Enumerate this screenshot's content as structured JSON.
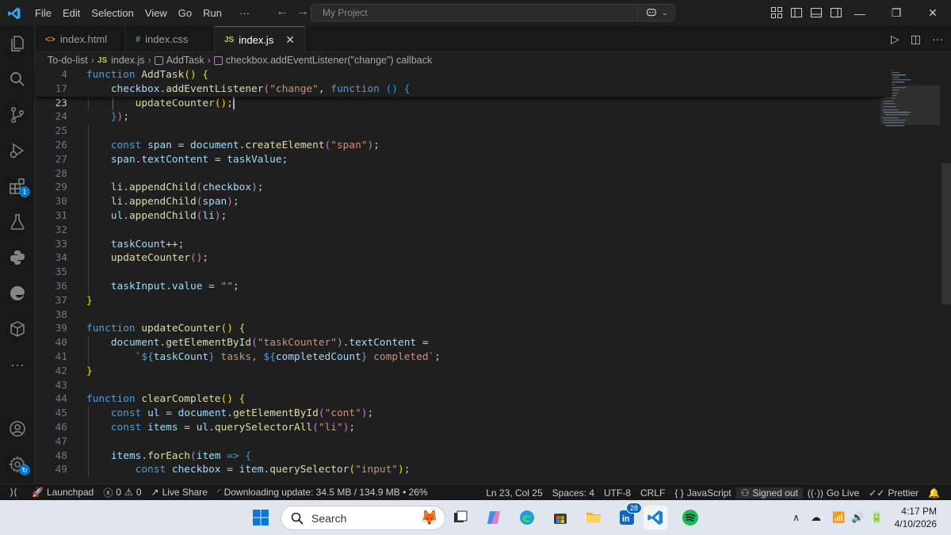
{
  "menu": [
    "File",
    "Edit",
    "Selection",
    "View",
    "Go",
    "Run"
  ],
  "menu_more": "···",
  "command_center": {
    "placeholder": "My Project"
  },
  "tabs": [
    {
      "icon": "<>",
      "label": "index.html",
      "active": false
    },
    {
      "icon": "#",
      "label": "index.css",
      "active": false
    },
    {
      "icon": "JS",
      "label": "index.js",
      "active": true
    }
  ],
  "breadcrumb": {
    "folder": "To-do-list",
    "file_icon": "JS",
    "file": "index.js",
    "symbol1": "AddTask",
    "symbol2": "checkbox.addEventListener(\"change\") callback"
  },
  "activity_badge": "1",
  "code_lines": [
    {
      "n": "4",
      "sticky": true,
      "tokens": [
        [
          "kw",
          "function "
        ],
        [
          "fn",
          "AddTask"
        ],
        [
          "br1",
          "() {"
        ]
      ]
    },
    {
      "n": "17",
      "sticky": true,
      "tokens": [
        [
          "plain",
          "    "
        ],
        [
          "var",
          "checkbox"
        ],
        [
          "plain",
          "."
        ],
        [
          "fn",
          "addEventListener"
        ],
        [
          "br2",
          "("
        ],
        [
          "str",
          "\"change\""
        ],
        [
          "plain",
          ", "
        ],
        [
          "kw",
          "function "
        ],
        [
          "br3",
          "() {"
        ]
      ]
    },
    {
      "n": "23",
      "current": true,
      "tokens": [
        [
          "plain",
          "        "
        ],
        [
          "fn",
          "updateCounter"
        ],
        [
          "br1",
          "()"
        ],
        [
          "plain",
          ";"
        ]
      ]
    },
    {
      "n": "24",
      "tokens": [
        [
          "plain",
          "    "
        ],
        [
          "br3",
          "}"
        ],
        [
          "br2",
          ")"
        ],
        [
          "plain",
          ";"
        ]
      ]
    },
    {
      "n": "25",
      "tokens": []
    },
    {
      "n": "26",
      "tokens": [
        [
          "plain",
          "    "
        ],
        [
          "kw",
          "const "
        ],
        [
          "var",
          "span"
        ],
        [
          "plain",
          " = "
        ],
        [
          "var",
          "document"
        ],
        [
          "plain",
          "."
        ],
        [
          "fn",
          "createElement"
        ],
        [
          "br2",
          "("
        ],
        [
          "str",
          "\"span\""
        ],
        [
          "br2",
          ")"
        ],
        [
          "plain",
          ";"
        ]
      ]
    },
    {
      "n": "27",
      "tokens": [
        [
          "plain",
          "    "
        ],
        [
          "var",
          "span"
        ],
        [
          "plain",
          "."
        ],
        [
          "var",
          "textContent"
        ],
        [
          "plain",
          " = "
        ],
        [
          "var",
          "taskValue"
        ],
        [
          "plain",
          ";"
        ]
      ]
    },
    {
      "n": "28",
      "tokens": []
    },
    {
      "n": "29",
      "tokens": [
        [
          "plain",
          "    "
        ],
        [
          "var",
          "li"
        ],
        [
          "plain",
          "."
        ],
        [
          "fn",
          "appendChild"
        ],
        [
          "br2",
          "("
        ],
        [
          "var",
          "checkbox"
        ],
        [
          "br2",
          ")"
        ],
        [
          "plain",
          ";"
        ]
      ]
    },
    {
      "n": "30",
      "tokens": [
        [
          "plain",
          "    "
        ],
        [
          "var",
          "li"
        ],
        [
          "plain",
          "."
        ],
        [
          "fn",
          "appendChild"
        ],
        [
          "br2",
          "("
        ],
        [
          "var",
          "span"
        ],
        [
          "br2",
          ")"
        ],
        [
          "plain",
          ";"
        ]
      ]
    },
    {
      "n": "31",
      "tokens": [
        [
          "plain",
          "    "
        ],
        [
          "var",
          "ul"
        ],
        [
          "plain",
          "."
        ],
        [
          "fn",
          "appendChild"
        ],
        [
          "br2",
          "("
        ],
        [
          "var",
          "li"
        ],
        [
          "br2",
          ")"
        ],
        [
          "plain",
          ";"
        ]
      ]
    },
    {
      "n": "32",
      "tokens": []
    },
    {
      "n": "33",
      "tokens": [
        [
          "plain",
          "    "
        ],
        [
          "var",
          "taskCount"
        ],
        [
          "plain",
          "++;"
        ]
      ]
    },
    {
      "n": "34",
      "tokens": [
        [
          "plain",
          "    "
        ],
        [
          "fn",
          "updateCounter"
        ],
        [
          "br2",
          "()"
        ],
        [
          "plain",
          ";"
        ]
      ]
    },
    {
      "n": "35",
      "tokens": []
    },
    {
      "n": "36",
      "tokens": [
        [
          "plain",
          "    "
        ],
        [
          "var",
          "taskInput"
        ],
        [
          "plain",
          "."
        ],
        [
          "var",
          "value"
        ],
        [
          "plain",
          " = "
        ],
        [
          "str",
          "\"\""
        ],
        [
          "plain",
          ";"
        ]
      ]
    },
    {
      "n": "37",
      "tokens": [
        [
          "br1",
          "}"
        ]
      ]
    },
    {
      "n": "38",
      "tokens": []
    },
    {
      "n": "39",
      "tokens": [
        [
          "kw",
          "function "
        ],
        [
          "fn",
          "updateCounter"
        ],
        [
          "br1",
          "() {"
        ]
      ]
    },
    {
      "n": "40",
      "tokens": [
        [
          "plain",
          "    "
        ],
        [
          "var",
          "document"
        ],
        [
          "plain",
          "."
        ],
        [
          "fn",
          "getElementById"
        ],
        [
          "br2",
          "("
        ],
        [
          "str",
          "\"taskCounter\""
        ],
        [
          "br2",
          ")"
        ],
        [
          "plain",
          "."
        ],
        [
          "var",
          "textContent"
        ],
        [
          "plain",
          " ="
        ]
      ]
    },
    {
      "n": "41",
      "tokens": [
        [
          "plain",
          "        "
        ],
        [
          "str",
          "`"
        ],
        [
          "kw",
          "${"
        ],
        [
          "var",
          "taskCount"
        ],
        [
          "kw",
          "}"
        ],
        [
          "str",
          " tasks, "
        ],
        [
          "kw",
          "${"
        ],
        [
          "var",
          "completedCount"
        ],
        [
          "kw",
          "}"
        ],
        [
          "str",
          " completed`"
        ],
        [
          "plain",
          ";"
        ]
      ]
    },
    {
      "n": "42",
      "tokens": [
        [
          "br1",
          "}"
        ]
      ]
    },
    {
      "n": "43",
      "tokens": []
    },
    {
      "n": "44",
      "tokens": [
        [
          "kw",
          "function "
        ],
        [
          "fn",
          "clearComplete"
        ],
        [
          "br1",
          "() {"
        ]
      ]
    },
    {
      "n": "45",
      "tokens": [
        [
          "plain",
          "    "
        ],
        [
          "kw",
          "const "
        ],
        [
          "var",
          "ul"
        ],
        [
          "plain",
          " = "
        ],
        [
          "var",
          "document"
        ],
        [
          "plain",
          "."
        ],
        [
          "fn",
          "getElementById"
        ],
        [
          "br2",
          "("
        ],
        [
          "str",
          "\"cont\""
        ],
        [
          "br2",
          ")"
        ],
        [
          "plain",
          ";"
        ]
      ]
    },
    {
      "n": "46",
      "tokens": [
        [
          "plain",
          "    "
        ],
        [
          "kw",
          "const "
        ],
        [
          "var",
          "items"
        ],
        [
          "plain",
          " = "
        ],
        [
          "var",
          "ul"
        ],
        [
          "plain",
          "."
        ],
        [
          "fn",
          "querySelectorAll"
        ],
        [
          "br2",
          "("
        ],
        [
          "str",
          "\"li\""
        ],
        [
          "br2",
          ")"
        ],
        [
          "plain",
          ";"
        ]
      ]
    },
    {
      "n": "47",
      "tokens": []
    },
    {
      "n": "48",
      "tokens": [
        [
          "plain",
          "    "
        ],
        [
          "var",
          "items"
        ],
        [
          "plain",
          "."
        ],
        [
          "fn",
          "forEach"
        ],
        [
          "br2",
          "("
        ],
        [
          "var",
          "item"
        ],
        [
          "plain",
          " "
        ],
        [
          "kw",
          "=>"
        ],
        [
          "plain",
          " "
        ],
        [
          "br3",
          "{"
        ]
      ]
    },
    {
      "n": "49",
      "tokens": [
        [
          "plain",
          "        "
        ],
        [
          "kw",
          "const "
        ],
        [
          "var",
          "checkbox"
        ],
        [
          "plain",
          " = "
        ],
        [
          "var",
          "item"
        ],
        [
          "plain",
          "."
        ],
        [
          "fn",
          "querySelector"
        ],
        [
          "br1",
          "("
        ],
        [
          "str",
          "\"input\""
        ],
        [
          "br1",
          ")"
        ],
        [
          "plain",
          ";"
        ]
      ]
    }
  ],
  "statusbar": {
    "launchpad": "Launchpad",
    "errors": "0",
    "warnings": "0",
    "live_share": "Live Share",
    "download": "Downloading update: 34.5 MB / 134.9 MB • 26%",
    "position": "Ln 23, Col 25",
    "spaces": "Spaces: 4",
    "encoding": "UTF-8",
    "eol": "CRLF",
    "language": "JavaScript",
    "account": "Signed out",
    "go_live": "Go Live",
    "prettier": "Prettier"
  },
  "taskbar": {
    "search": "Search",
    "linkedin_badge": "28",
    "time": "4:17 PM",
    "date": "4/10/2026"
  },
  "colors": {
    "accent": "#0078d4",
    "keyword": "#569cd6",
    "function": "#dcdcaa",
    "variable": "#9cdcfe",
    "string": "#ce9178"
  }
}
